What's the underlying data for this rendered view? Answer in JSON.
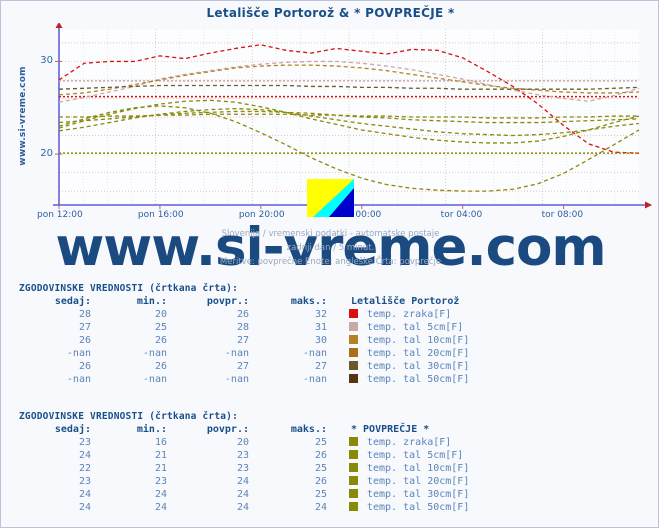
{
  "page": {
    "title": "Letališče Portorož & * POVPREČJE *",
    "vertical_url": "www.si-vreme.com",
    "watermark": "www.si-vreme.com",
    "caption_line1": "Slovenija / vremenski podatki - avtomatske postaje",
    "caption_line2": "zadnji dan / 5 minut.",
    "caption_line3": "Meritve: povprečne  Enote: angleške  Črta: povprečje",
    "logo_icon": "si-vreme-flag-icon"
  },
  "axes": {
    "y_ticks": [
      "30",
      "20"
    ],
    "x_ticks": [
      "pon 12:00",
      "pon 16:00",
      "pon 20:00",
      "tor 00:00",
      "tor 04:00",
      "tor 08:00"
    ],
    "ylim": [
      14.5,
      33.5
    ],
    "grid": true
  },
  "legend_blocks": [
    {
      "title": "ZGODOVINSKE VREDNOSTI (črtkana črta):",
      "headers": {
        "sedaj": "sedaj:",
        "min": "min.:",
        "povpr": "povpr.:",
        "maks": "maks.:",
        "station": "Letališče Portorož"
      },
      "rows": [
        {
          "sedaj": "28",
          "min": "20",
          "povpr": "26",
          "maks": "32",
          "label": "temp. zraka[F]",
          "color": "#d81010"
        },
        {
          "sedaj": "27",
          "min": "25",
          "povpr": "28",
          "maks": "31",
          "label": "temp. tal  5cm[F]",
          "color": "#c9a8a8"
        },
        {
          "sedaj": "26",
          "min": "26",
          "povpr": "27",
          "maks": "30",
          "label": "temp. tal 10cm[F]",
          "color": "#b5821f"
        },
        {
          "sedaj": "-nan",
          "min": "-nan",
          "povpr": "-nan",
          "maks": "-nan",
          "label": "temp. tal 20cm[F]",
          "color": "#a8701a"
        },
        {
          "sedaj": "26",
          "min": "26",
          "povpr": "27",
          "maks": "27",
          "label": "temp. tal 30cm[F]",
          "color": "#6b5b2a"
        },
        {
          "sedaj": "-nan",
          "min": "-nan",
          "povpr": "-nan",
          "maks": "-nan",
          "label": "temp. tal 50cm[F]",
          "color": "#5c3310"
        }
      ]
    },
    {
      "title": "ZGODOVINSKE VREDNOSTI (črtkana črta):",
      "headers": {
        "sedaj": "sedaj:",
        "min": "min.:",
        "povpr": "povpr.:",
        "maks": "maks.:",
        "station": "* POVPREČJE *"
      },
      "rows": [
        {
          "sedaj": "23",
          "min": "16",
          "povpr": "20",
          "maks": "25",
          "label": "temp. zraka[F]",
          "color": "#8a8a0a"
        },
        {
          "sedaj": "24",
          "min": "21",
          "povpr": "23",
          "maks": "26",
          "label": "temp. tal  5cm[F]",
          "color": "#8a8a0a"
        },
        {
          "sedaj": "22",
          "min": "21",
          "povpr": "23",
          "maks": "25",
          "label": "temp. tal 10cm[F]",
          "color": "#8a8a0a"
        },
        {
          "sedaj": "23",
          "min": "23",
          "povpr": "24",
          "maks": "26",
          "label": "temp. tal 20cm[F]",
          "color": "#8a8a0a"
        },
        {
          "sedaj": "24",
          "min": "24",
          "povpr": "24",
          "maks": "25",
          "label": "temp. tal 30cm[F]",
          "color": "#8a8a0a"
        },
        {
          "sedaj": "24",
          "min": "24",
          "povpr": "24",
          "maks": "24",
          "label": "temp. tal 50cm[F]",
          "color": "#8a8a0a"
        }
      ]
    }
  ],
  "chart_data": {
    "type": "line",
    "title": "Letališče Portorož & * POVPREČJE *",
    "xlabel": "",
    "ylabel": "",
    "ylim": [
      14.5,
      33.5
    ],
    "yticks": [
      20,
      30
    ],
    "x_tick_labels": [
      "pon 12:00",
      "pon 16:00",
      "pon 20:00",
      "tor 00:00",
      "tor 04:00",
      "tor 08:00"
    ],
    "x_tick_positions": [
      0.0,
      0.174,
      0.348,
      0.522,
      0.696,
      0.87
    ],
    "x_count": 24,
    "series": [
      {
        "name": "Letališče Portorož — temp. zraka[F]",
        "color": "#d81010",
        "style": "dashed",
        "values": [
          28.0,
          29.8,
          30.0,
          30.0,
          30.6,
          30.3,
          30.9,
          31.4,
          31.8,
          31.2,
          30.9,
          31.4,
          31.1,
          30.8,
          31.3,
          31.2,
          30.4,
          28.9,
          27.3,
          25.4,
          23.1,
          21.1,
          20.2,
          20.1
        ]
      },
      {
        "name": "Letališče Portorož — temp. zraka avg ref",
        "color": "#d81010",
        "style": "dotted-flat",
        "values": [
          26.2,
          26.2,
          26.2,
          26.2,
          26.2,
          26.2,
          26.2,
          26.2,
          26.2,
          26.2,
          26.2,
          26.2,
          26.2,
          26.2,
          26.2,
          26.2,
          26.2,
          26.2,
          26.2,
          26.2,
          26.2,
          26.2,
          26.2,
          26.2
        ]
      },
      {
        "name": "Letališče Portorož — temp. tal 5cm[F]",
        "color": "#c9a8a8",
        "style": "dashed",
        "values": [
          25.6,
          26.1,
          26.7,
          27.3,
          28.1,
          28.6,
          29.0,
          29.4,
          29.7,
          29.9,
          30.0,
          30.0,
          29.8,
          29.5,
          29.1,
          28.6,
          28.1,
          27.5,
          26.9,
          26.4,
          26.0,
          25.7,
          26.3,
          27.1
        ]
      },
      {
        "name": "Letališče Portorož — temp. tal 5cm avg ref",
        "color": "#c9a8a8",
        "style": "dotted-flat",
        "values": [
          27.9,
          27.9,
          27.9,
          27.9,
          27.9,
          27.9,
          27.9,
          27.9,
          27.9,
          27.9,
          27.9,
          27.9,
          27.9,
          27.9,
          27.9,
          27.9,
          27.9,
          27.9,
          27.9,
          27.9,
          27.9,
          27.9,
          27.9,
          27.9
        ]
      },
      {
        "name": "Letališče Portorož — temp. tal 10cm[F]",
        "color": "#b5821f",
        "style": "dashed",
        "values": [
          26.4,
          26.6,
          27.0,
          27.5,
          28.0,
          28.5,
          28.9,
          29.3,
          29.5,
          29.6,
          29.6,
          29.5,
          29.3,
          29.0,
          28.6,
          28.2,
          27.8,
          27.4,
          27.1,
          26.9,
          26.7,
          26.6,
          26.6,
          26.7
        ]
      },
      {
        "name": "Letališče Portorož — temp. tal 30cm[F]",
        "color": "#6b5b2a",
        "style": "dashed",
        "values": [
          27.0,
          27.1,
          27.2,
          27.3,
          27.4,
          27.4,
          27.4,
          27.4,
          27.4,
          27.4,
          27.3,
          27.3,
          27.2,
          27.2,
          27.1,
          27.1,
          27.0,
          27.0,
          27.0,
          27.0,
          27.0,
          27.0,
          27.1,
          27.2
        ]
      },
      {
        "name": "* POVPREČJE * — temp. zraka[F]",
        "color": "#8a8a0a",
        "style": "dashed",
        "values": [
          23.0,
          23.8,
          24.5,
          25.0,
          25.2,
          25.0,
          24.4,
          23.5,
          22.3,
          21.0,
          19.6,
          18.4,
          17.4,
          16.7,
          16.3,
          16.1,
          16.0,
          16.0,
          16.2,
          16.8,
          17.9,
          19.4,
          21.0,
          22.6
        ]
      },
      {
        "name": "* POVPREČJE * — temp. tal 5cm[F]",
        "color": "#8a8a0a",
        "style": "dashed",
        "values": [
          22.8,
          23.6,
          24.3,
          24.9,
          25.4,
          25.7,
          25.8,
          25.6,
          25.1,
          24.5,
          23.8,
          23.2,
          22.6,
          22.2,
          21.8,
          21.5,
          21.3,
          21.2,
          21.2,
          21.4,
          21.9,
          22.6,
          23.4,
          24.1
        ]
      },
      {
        "name": "* POVPREČJE * — temp. tal 10cm[F]",
        "color": "#8a8a0a",
        "style": "dashed",
        "values": [
          22.5,
          22.9,
          23.4,
          23.9,
          24.3,
          24.6,
          24.8,
          24.9,
          24.8,
          24.5,
          24.1,
          23.7,
          23.3,
          23.0,
          22.7,
          22.4,
          22.2,
          22.1,
          22.0,
          22.1,
          22.3,
          22.6,
          23.0,
          23.3
        ]
      },
      {
        "name": "* POVPREČJE * — temp. tal 20cm[F]",
        "color": "#8a8a0a",
        "style": "dashed",
        "values": [
          23.4,
          23.6,
          23.8,
          24.0,
          24.2,
          24.4,
          24.5,
          24.6,
          24.6,
          24.5,
          24.4,
          24.2,
          24.0,
          23.9,
          23.7,
          23.6,
          23.5,
          23.4,
          23.4,
          23.4,
          23.5,
          23.6,
          23.7,
          23.8
        ]
      },
      {
        "name": "* POVPREČJE * — temp. tal 30cm[F]",
        "color": "#8a8a0a",
        "style": "dashed",
        "values": [
          24.0,
          24.0,
          24.1,
          24.1,
          24.2,
          24.2,
          24.3,
          24.3,
          24.3,
          24.3,
          24.2,
          24.2,
          24.1,
          24.1,
          24.0,
          24.0,
          24.0,
          23.9,
          23.9,
          23.9,
          24.0,
          24.0,
          24.1,
          24.1
        ]
      },
      {
        "name": "* POVPREČJE * — temp. tal 50cm[F]",
        "color": "#8a8a0a",
        "style": "dotted-flat",
        "values": [
          20.1,
          20.1,
          20.1,
          20.1,
          20.1,
          20.1,
          20.1,
          20.1,
          20.1,
          20.1,
          20.1,
          20.1,
          20.1,
          20.1,
          20.1,
          20.1,
          20.1,
          20.1,
          20.1,
          20.1,
          20.1,
          20.1,
          20.1,
          20.1
        ]
      }
    ]
  }
}
